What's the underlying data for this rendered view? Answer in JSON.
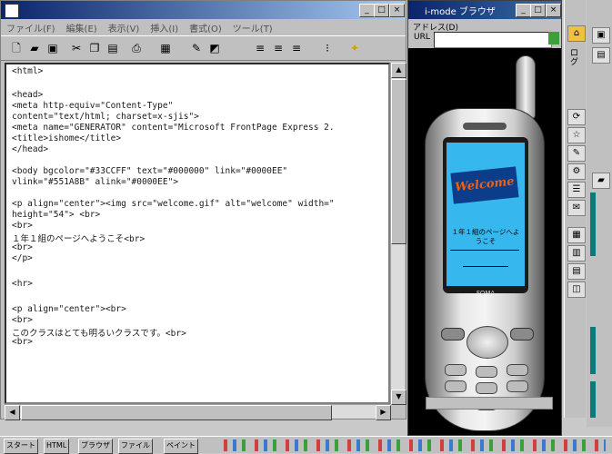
{
  "editor": {
    "title": "",
    "menu": [
      "ファイル(F)",
      "編集(E)",
      "表示(V)",
      "挿入(I)",
      "書式(O)",
      "ツール(T)"
    ],
    "toolbar_icons": [
      "new-icon",
      "open-icon",
      "save-icon",
      "cut-icon",
      "copy-icon",
      "paste-icon",
      "print-icon",
      "image-icon",
      "bold-icon",
      "align-icon"
    ],
    "code_lines": [
      "<html>",
      "",
      "<head>",
      "<meta http-equiv=\"Content-Type\"",
      "content=\"text/html; charset=x-sjis\">",
      "<meta name=\"GENERATOR\" content=\"Microsoft FrontPage Express 2.",
      "<title>ishome</title>",
      "</head>",
      "",
      "<body bgcolor=\"#33CCFF\" text=\"#000000\" link=\"#0000EE\"",
      "vlink=\"#551A8B\" alink=\"#0000EE\">",
      "",
      "<p align=\"center\"><img src=\"welcome.gif\" alt=\"welcome\" width=\"",
      "height=\"54\"> <br>",
      "<br>",
      "１年１組のページへようこそ<br>",
      "<br>",
      "</p>",
      "",
      "<hr>",
      "",
      "<p align=\"center\"><br>",
      "<br>",
      "このクラスはとても明るいクラスです。<br>",
      "<br>"
    ]
  },
  "simulator": {
    "title": "i-mode ブラウザ",
    "address_label": "アドレス(D)",
    "url_label": "URL",
    "url_value": "",
    "welcome_image_text": "Welcome",
    "screen_text": "１年１組のページへようこそ",
    "brand": "FOMA"
  },
  "right_toolbar": {
    "vertical_label": "ログ",
    "icons": [
      "home-icon",
      "refresh-icon",
      "bookmark-icon",
      "edit-icon",
      "settings-icon",
      "list-icon",
      "mail-icon",
      "grid-icon",
      "chart-icon"
    ]
  },
  "taskbar": {
    "items": [
      "スタート",
      "HTML",
      "ブラウザ",
      "ファイル",
      "ペイント"
    ]
  }
}
